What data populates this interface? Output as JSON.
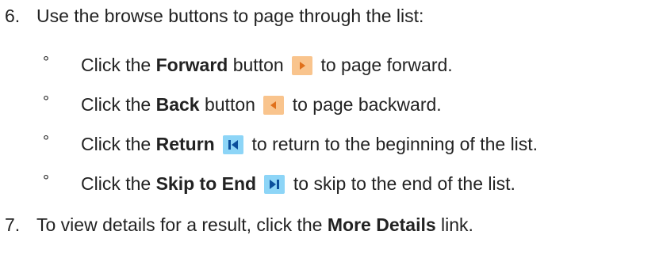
{
  "steps": [
    {
      "number": "6.",
      "text": "Use the browse buttons to page through the list:",
      "bullet": "°",
      "subitems": [
        {
          "prefix": "Click the ",
          "bold": "Forward",
          "middle": " button",
          "suffix": " to page forward.",
          "icon": "forward-arrow-icon"
        },
        {
          "prefix": "Click the ",
          "bold": "Back",
          "middle": " button",
          "suffix": " to page backward.",
          "icon": "back-arrow-icon"
        },
        {
          "prefix": "Click the ",
          "bold": "Return",
          "middle": "",
          "suffix": " to return to the beginning of the list.",
          "icon": "return-to-start-icon"
        },
        {
          "prefix": "Click the ",
          "bold": "Skip to End",
          "middle": "",
          "suffix": " to skip to the end of the list.",
          "icon": "skip-to-end-icon"
        }
      ]
    },
    {
      "number": "7.",
      "text_prefix": "To view details for a result, click the ",
      "text_bold": "More Details",
      "text_suffix": " link."
    }
  ],
  "colors": {
    "orange_button_bg": "#f9c48d",
    "orange_arrow": "#e0701b",
    "blue_button_bg": "#8dd5f7",
    "blue_arrow": "#0b4f9c",
    "text": "#222222"
  }
}
